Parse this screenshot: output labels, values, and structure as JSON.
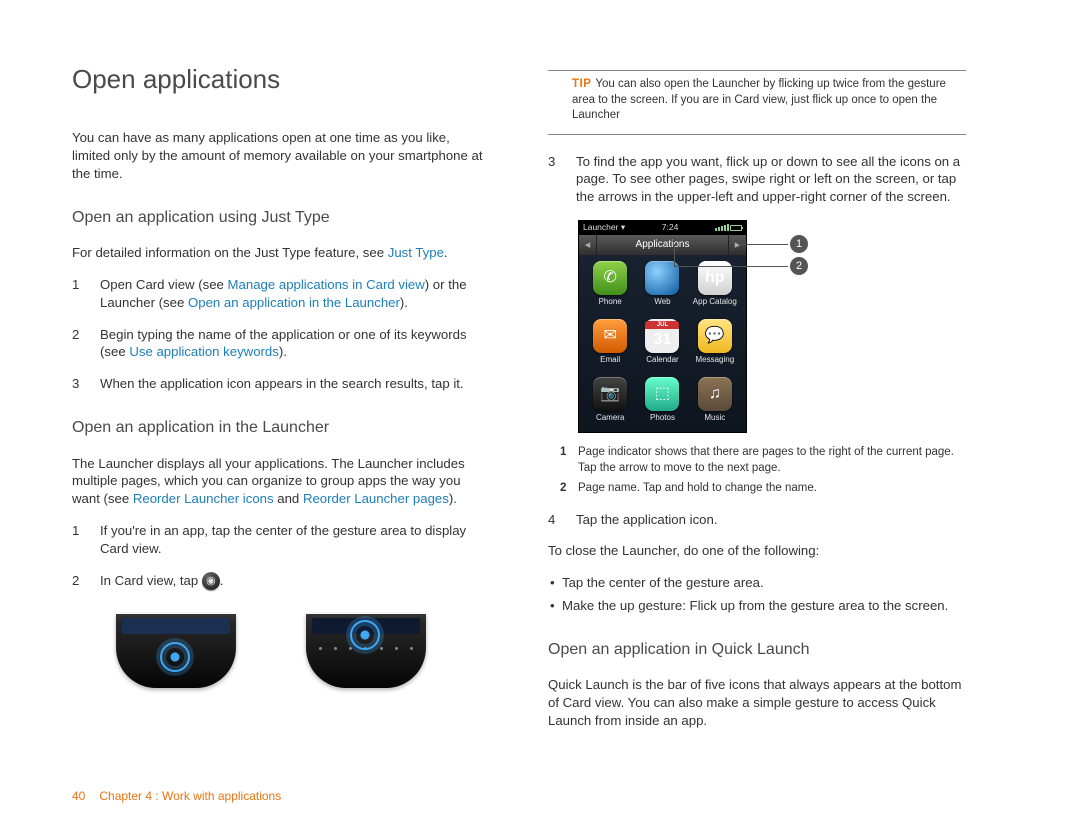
{
  "left": {
    "h1": "Open applications",
    "intro": "You can have as many applications open at one time as you like, limited only by the amount of memory available on your smartphone at the time.",
    "sec1": {
      "h2": "Open an application using Just Type",
      "lead_a": "For detailed information on the Just Type feature, see ",
      "lead_link": "Just Type",
      "lead_b": ".",
      "s1_a": "Open Card view (see ",
      "s1_l1": "Manage applications in Card view",
      "s1_b": ") or the Launcher (see ",
      "s1_l2": "Open an application in the Launcher",
      "s1_c": ").",
      "s2_a": "Begin typing the name of the application or one of its keywords (see ",
      "s2_l1": "Use application keywords",
      "s2_b": ").",
      "s3": "When the application icon appears in the search results, tap it."
    },
    "sec2": {
      "h2": "Open an application in the Launcher",
      "lead_a": "The Launcher displays all your applications. The Launcher includes multiple pages, which you can organize to group apps the way you want (see ",
      "lead_l1": "Reorder Launcher icons",
      "lead_mid": " and ",
      "lead_l2": "Reorder Launcher pages",
      "lead_b": ").",
      "s1": "If you're in an app, tap the center of the gesture area to display Card view.",
      "s2_a": "In Card view, tap ",
      "s2_b": "."
    }
  },
  "right": {
    "tip_label": "TIP",
    "tip_body": "You can also open the Launcher by flicking up twice from the gesture area to the screen. If you are in Card view, just flick up once to open the Launcher",
    "s3": "To find the app you want, flick up or down to see all the icons on a page. To see other pages, swipe right or left on the screen, or tap the arrows in the upper-left and upper-right corner of the screen.",
    "shot": {
      "status_left": "Launcher",
      "status_time": "7:24",
      "header": "Applications",
      "apps": [
        "Phone",
        "Web",
        "App Catalog",
        "Email",
        "Calendar",
        "Messaging",
        "Camera",
        "Photos",
        "Music"
      ],
      "cal_month": "JUL",
      "cal_day": "31"
    },
    "legend": {
      "n1": "Page indicator shows that there are pages to the right of the current page. Tap the arrow to move to the next page.",
      "n2": "Page name. Tap and hold to change the name."
    },
    "s4": "Tap the application icon.",
    "close_intro": "To close the Launcher, do one of the following:",
    "bullets": [
      "Tap the center of the gesture area.",
      "Make the up gesture: Flick up from the gesture area to the screen."
    ],
    "sec3": {
      "h2": "Open an application in Quick Launch",
      "body": "Quick Launch is the bar of five icons that always appears at the bottom of Card view. You can also make a simple gesture to access Quick Launch from inside an app."
    }
  },
  "footer": {
    "page": "40",
    "chapter": "Chapter 4 : Work with applications"
  }
}
